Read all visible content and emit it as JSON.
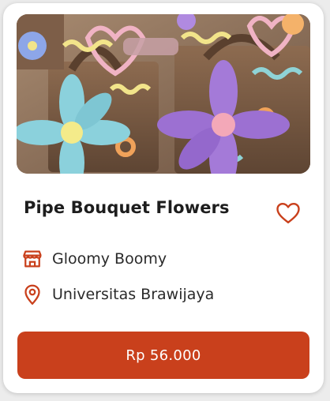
{
  "product": {
    "title": "Pipe Bouquet Flowers",
    "image_subject": "photo-pipe-cleaner-flower-bouquets",
    "favorite_icon": "heart-outline-icon"
  },
  "shop": {
    "icon": "store-icon",
    "name": "Gloomy Boomy"
  },
  "location": {
    "icon": "map-pin-icon",
    "name": "Universitas Brawijaya"
  },
  "price": {
    "label": "Rp 56.000"
  },
  "colors": {
    "accent": "#c9401c",
    "title": "#1d1d1d",
    "text": "#2a2a2a",
    "card": "#ffffff"
  }
}
